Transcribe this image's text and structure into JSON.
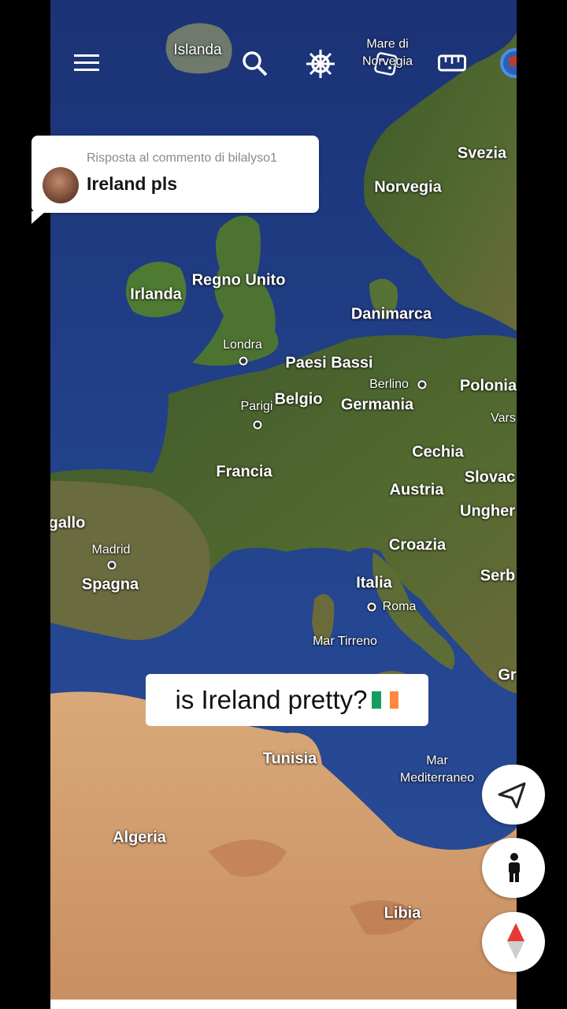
{
  "toolbar": {
    "icons": [
      "menu-icon",
      "search-icon",
      "ships-wheel-icon",
      "dice-icon",
      "ruler-icon",
      "globe-icon"
    ]
  },
  "comment": {
    "reply_to": "Risposta al commento di bilalyso1",
    "text": "Ireland pls"
  },
  "caption": {
    "text": "is Ireland pretty?",
    "flag_colors": [
      "#169b62",
      "#ffffff",
      "#ff883e"
    ]
  },
  "map": {
    "countries": {
      "islanda": "Islanda",
      "svezia": "Svezia",
      "norvegia": "Norvegia",
      "irlanda": "Irlanda",
      "regno_unito": "Regno Unito",
      "danimarca": "Danimarca",
      "paesi_bassi": "Paesi Bassi",
      "polonia": "Polonia",
      "belgio": "Belgio",
      "germania": "Germania",
      "cechia": "Cechia",
      "francia": "Francia",
      "slovacchia": "Slovac",
      "austria": "Austria",
      "ungheria": "Ungher",
      "portogallo": "gallo",
      "croazia": "Croazia",
      "serbia": "Serb",
      "spagna": "Spagna",
      "italia": "Italia",
      "grecia": "Gr",
      "tunisia": "Tunisia",
      "algeria": "Algeria",
      "libia": "Libia"
    },
    "cities": {
      "londra": "Londra",
      "berlino": "Berlino",
      "parigi": "Parigi",
      "varsavia": "Vars",
      "madrid": "Madrid",
      "roma": "Roma"
    },
    "seas": {
      "norvegia_line1": "Mare di",
      "norvegia_line2": "Norvegia",
      "tirreno": "Mar Tirreno",
      "mediterraneo_line1": "Mar",
      "mediterraneo_line2": "Mediterraneo"
    }
  },
  "side_buttons": [
    "navigate-icon",
    "pegman-icon",
    "compass-icon"
  ]
}
